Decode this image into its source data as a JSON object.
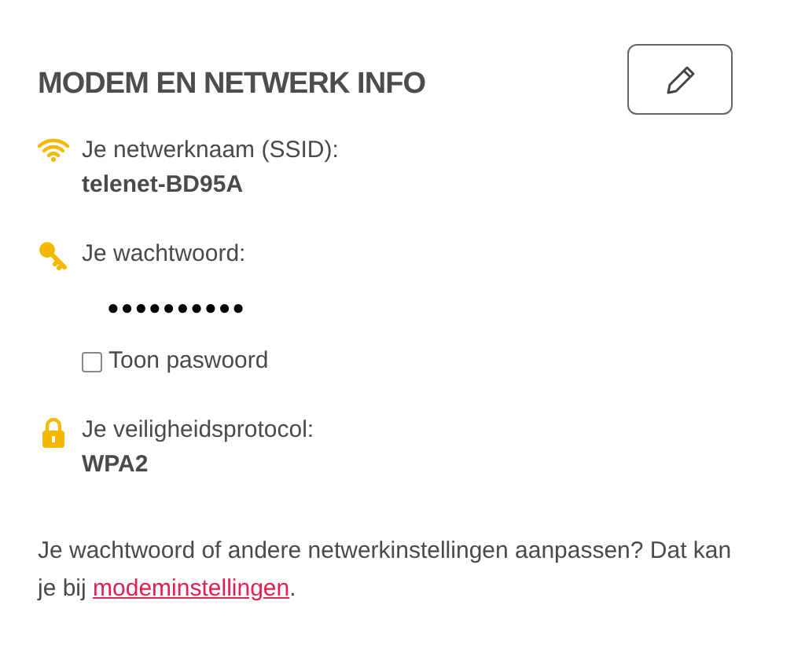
{
  "title": "MODEM EN NETWERK INFO",
  "items": [
    {
      "kind": "ssid",
      "label": "Je netwerknaam (SSID):",
      "value": "telenet-BD95A"
    },
    {
      "kind": "password",
      "label": "Je wachtwoord:",
      "value": "●●●●●●●●●●",
      "toggle": {
        "label": "Toon paswoord",
        "checked": false
      }
    },
    {
      "kind": "protocol",
      "label": "Je veiligheidsprotocol:",
      "value": "WPA2"
    }
  ],
  "footer": {
    "text": "Je wachtwoord of andere netwerkinstellingen aanpassen? Dat kan je bij ",
    "link": "modeminstellingen",
    "after": "."
  }
}
